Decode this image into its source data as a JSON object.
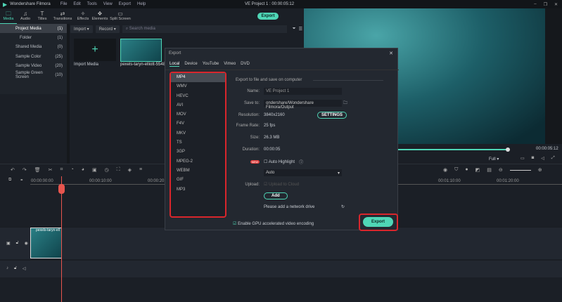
{
  "app": {
    "title": "Wondershare Filmora",
    "project": "VE Project 1 : 00:00:05:12",
    "menu": [
      "File",
      "Edit",
      "Tools",
      "View",
      "Export",
      "Help"
    ]
  },
  "toolbar": {
    "tabs": [
      {
        "label": "Media",
        "icon": "folder-icon"
      },
      {
        "label": "Audio",
        "icon": "music-icon"
      },
      {
        "label": "Titles",
        "icon": "text-icon"
      },
      {
        "label": "Transitions",
        "icon": "transition-icon"
      },
      {
        "label": "Effects",
        "icon": "effects-icon"
      },
      {
        "label": "Elements",
        "icon": "elements-icon"
      },
      {
        "label": "Split Screen",
        "icon": "split-screen-icon"
      }
    ],
    "export": "Export"
  },
  "sidebar": {
    "items": [
      {
        "label": "Project Media",
        "count": "(1)"
      },
      {
        "label": "Folder",
        "count": "(1)"
      },
      {
        "label": "Shared Media",
        "count": "(0)"
      },
      {
        "label": "Sample Color",
        "count": "(25)"
      },
      {
        "label": "Sample Video",
        "count": "(20)"
      },
      {
        "label": "Sample Green Screen",
        "count": "(10)"
      }
    ]
  },
  "media": {
    "import": "Import",
    "record": "Record",
    "search_placeholder": "Search media",
    "import_media": "Import Media",
    "clip": "pexels-taryn-elliott-5548..."
  },
  "preview": {
    "timecode": "00:00:05:12",
    "quality": "Full"
  },
  "timeline": {
    "ruler": [
      "00:00:00:00",
      "00:00:10:00",
      "00:00:20:00",
      "00:01:10:00",
      "00:01:20:00"
    ],
    "clip": "pexels-taryn-ell"
  },
  "dialog": {
    "title": "Export",
    "tabs": [
      "Local",
      "Device",
      "YouTube",
      "Vimeo",
      "DVD"
    ],
    "formats": [
      "MP4",
      "WMV",
      "HEVC",
      "AVI",
      "MOV",
      "F4V",
      "MKV",
      "TS",
      "3GP",
      "MPEG-2",
      "WEBM",
      "GIF",
      "MP3"
    ],
    "heading": "Export to file and save on computer",
    "name_label": "Name:",
    "name": "VE Project 1",
    "save_label": "Save to:",
    "save": "ondershare/Wondershare Filmora/Output",
    "res_label": "Resolution:",
    "res": "3840x2160",
    "settings": "SETTINGS",
    "fps_label": "Frame Rate:",
    "fps": "25 fps",
    "size_label": "Size:",
    "size": "26.3 MB",
    "dur_label": "Duration:",
    "dur": "00:00:05",
    "new_badge": "NEW",
    "auto_highlight": "Auto Highlight",
    "auto": "Auto",
    "upload_label": "Upload:",
    "upload": "Upload to Cloud",
    "add": "Add",
    "network": "Please add a network drive",
    "gpu": "Enable GPU accelerated video encoding",
    "export": "Export"
  },
  "colors": {
    "accent": "#4fd6b6",
    "highlight": "#d9262c",
    "playhead": "#e8554e"
  }
}
